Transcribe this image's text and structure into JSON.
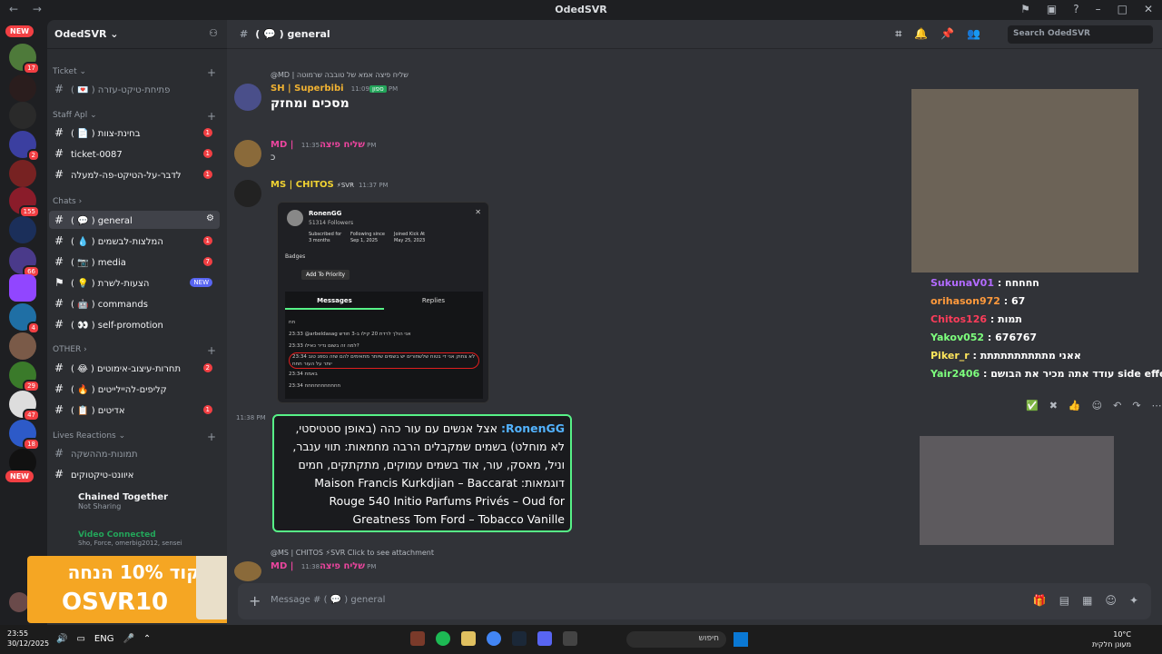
{
  "titlebar": {
    "title": "OdedSVR"
  },
  "servers": {
    "badges": [
      "NEW",
      "17",
      "2",
      "155",
      "66",
      "4",
      "29",
      "47",
      "18",
      "NEW"
    ]
  },
  "guild": {
    "name": "OdedSVR"
  },
  "categories": {
    "ticket": "Ticket",
    "staff": "Staff Apl",
    "chats": "Chats",
    "other": "OTHER",
    "lives": "Lives Reactions"
  },
  "channels": [
    {
      "name": "( 💌 ) פתיחת-טיקט-עזרה",
      "badge": ""
    },
    {
      "name": "( 📄 ) בחינת-צוות",
      "badge": "1"
    },
    {
      "name": "ticket-0087",
      "badge": "1"
    },
    {
      "name": "לדבר-על-הטיקט-פה-למעלה",
      "badge": "1"
    },
    {
      "name": "( 💬 ) general",
      "badge": ""
    },
    {
      "name": "( 💧 ) המלצות-לבשמים",
      "badge": "1"
    },
    {
      "name": "( 📷 ) media",
      "badge": "7"
    },
    {
      "name": "( 💡 ) הצעות-לשרת",
      "badge": "NEW"
    },
    {
      "name": "( 🤖 ) commands",
      "badge": ""
    },
    {
      "name": "( 👀 ) self-promotion",
      "badge": ""
    },
    {
      "name": "( 😂 ) תחרות-עיצוב-אימוטים",
      "badge": "2"
    },
    {
      "name": "( 🔥 ) קליפים-להיילייטים",
      "badge": ""
    },
    {
      "name": "( 📋 ) אדיטים",
      "badge": "1"
    },
    {
      "name": "תמונות-מההשקה",
      "badge": ""
    },
    {
      "name": "איוונט-טיקטוקים",
      "badge": ""
    }
  ],
  "voice": {
    "app": "Chained Together",
    "app_status": "Not Sharing",
    "connected": "Video Connected",
    "members": "Sho, Force, omerbig2012, sensei"
  },
  "promo": {
    "line1": "קוד 10% הנחה",
    "line2": "OSVR10"
  },
  "channel_header": {
    "name": "( 💬 ) general",
    "search_placeholder": "Search OdedSVR"
  },
  "messages": [
    {
      "reply": "@MD | שליח פיצה  אמא של טובבה שרמוטה",
      "author": "SH | Superbibi",
      "tag": "ספון",
      "time": "11:09 PM",
      "text": "מסכים ומחזק"
    },
    {
      "author": "MD | שליח פיצה",
      "time": "11:35 PM",
      "text": "כ"
    },
    {
      "author": "MS | CHITOS",
      "tag": "⚡SVR",
      "time": "11:37 PM",
      "text": ""
    },
    {
      "time_side": "11:38 PM"
    },
    {
      "reply": "@MS | CHITOS ⚡SVR Click to see attachment",
      "author": "MD | שליח פיצה",
      "time": "11:38 PM",
      "text": "די"
    }
  ],
  "popup": {
    "user": "RonenGG",
    "followers": "51314 Followers",
    "sub_label": "Subscribed for",
    "sub_value": "3 months",
    "follow_label": "Following since",
    "follow_value": "Sep 1, 2025",
    "joined_label": "Joined Kick At",
    "joined_value": "May 25, 2023",
    "badges_label": "Badges",
    "priority": "Add To Priority",
    "tab1": "Messages",
    "tab2": "Replies",
    "lines": [
      "חח",
      "23:33 @arbeldasag אני הולך לרדת 20 קילו ב-3 חודש",
      "23:33 למה זה בשום נדיר כאילו?",
      "23:34 לא צחוק אני די בטוח שלשחורים יש בשמים שיותר מתאימים להם שזה נספג טוב יותר על העור חחח",
      "23:34 באמת",
      "23:34 חחחחחחחחחחח"
    ]
  },
  "chatbox": {
    "user": "RonenGG:",
    "text": "אצל אנשים עם עור כהה (באופן סטטיסטי, לא מוחלט) בשמים שמקבלים הרבה מחמאות: תווי ענבר, וניל, מאסק, עור, אוד בשמים עמוקים, מתקתקים, חמים דוגמאות: Maison Francis Kurkdjian – Baccarat Rouge 540 Initio Parfums Privés – Oud for Greatness Tom Ford – Tobacco Vanille"
  },
  "overlay": [
    {
      "user": "SukunaV01",
      "text": "חחחחח"
    },
    {
      "user": "orihason972",
      "text": "67"
    },
    {
      "user": "Chitos126",
      "text": "תמות"
    },
    {
      "user": "Yakov052",
      "text": "676767"
    },
    {
      "user": "Piker_r",
      "text": "אאני מתתתתתתתתתת"
    },
    {
      "user": "Yair2406",
      "text": "עודד אתה מכיר את הבושם side effect"
    }
  ],
  "compose": {
    "placeholder": "Message # ( 💬 ) general"
  },
  "taskbar": {
    "time": "23:55",
    "date": "30/12/2025",
    "lang": "ENG",
    "search": "חיפוש",
    "temp": "10°C",
    "weather": "מעונן חלקית"
  }
}
